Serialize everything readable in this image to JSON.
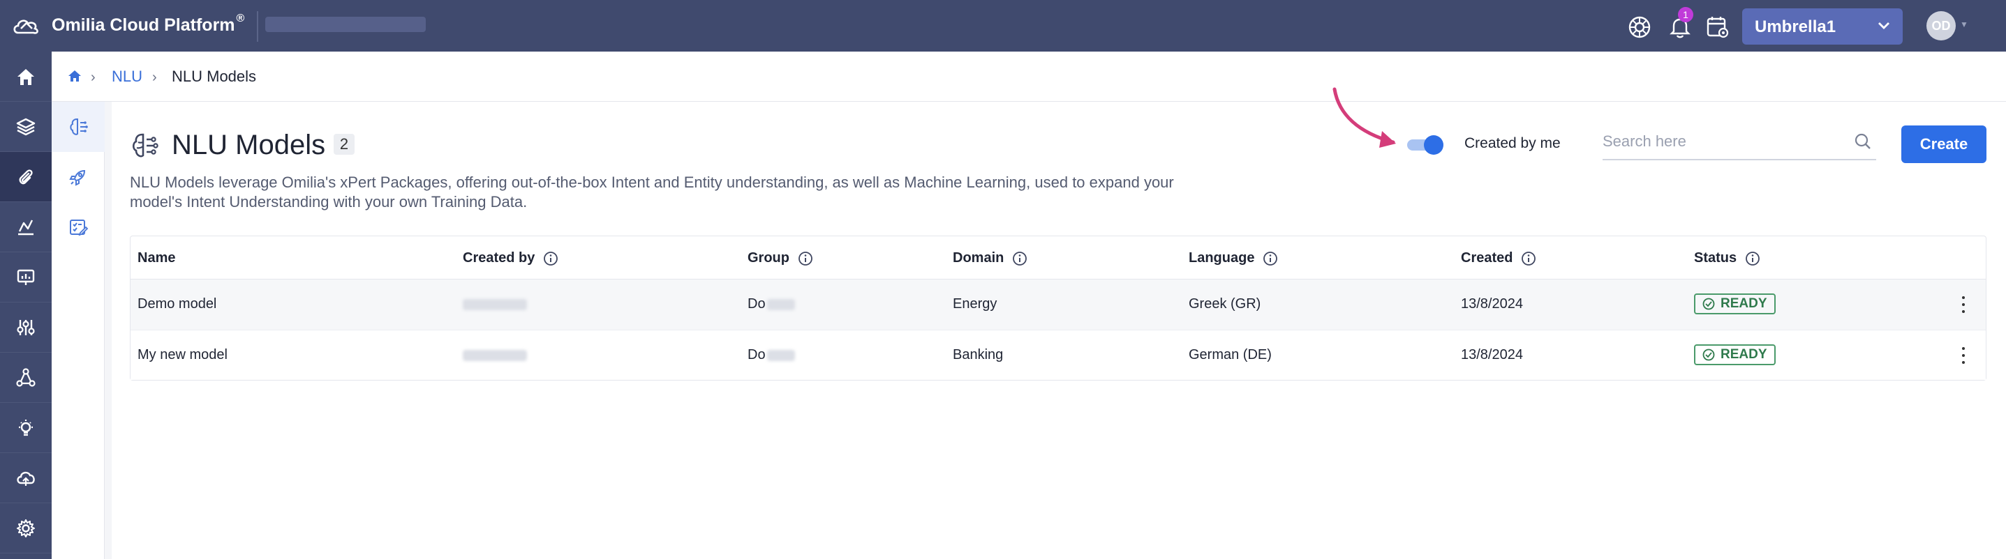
{
  "header": {
    "brand": "Omilia Cloud Platform",
    "registered": "®",
    "notification_count": "1",
    "tenant": "Umbrella1",
    "avatar_initials": "OD"
  },
  "breadcrumb": {
    "link": "NLU",
    "current": "NLU Models"
  },
  "page": {
    "title": "NLU Models",
    "count": "2",
    "description": "NLU Models leverage Omilia's xPert Packages, offering out-of-the-box Intent and Entity understanding, as well as Machine Learning, used to expand your model's Intent Understanding with your own Training Data."
  },
  "filters": {
    "toggle_label": "Created by me",
    "toggle_on": true,
    "search_placeholder": "Search here",
    "create_label": "Create"
  },
  "table": {
    "columns": [
      "Name",
      "Created by",
      "Group",
      "Domain",
      "Language",
      "Created",
      "Status"
    ],
    "rows": [
      {
        "name": "Demo model",
        "group": "Do",
        "domain": "Energy",
        "language": "Greek (GR)",
        "created": "13/8/2024",
        "status": "READY"
      },
      {
        "name": "My new model",
        "group": "Do",
        "domain": "Banking",
        "language": "German (DE)",
        "created": "13/8/2024",
        "status": "READY"
      }
    ]
  },
  "colors": {
    "topbar": "#404a6e",
    "accent": "#2d6ee6",
    "ready": "#2f7a4c",
    "annotation_arrow": "#d43d7a"
  }
}
